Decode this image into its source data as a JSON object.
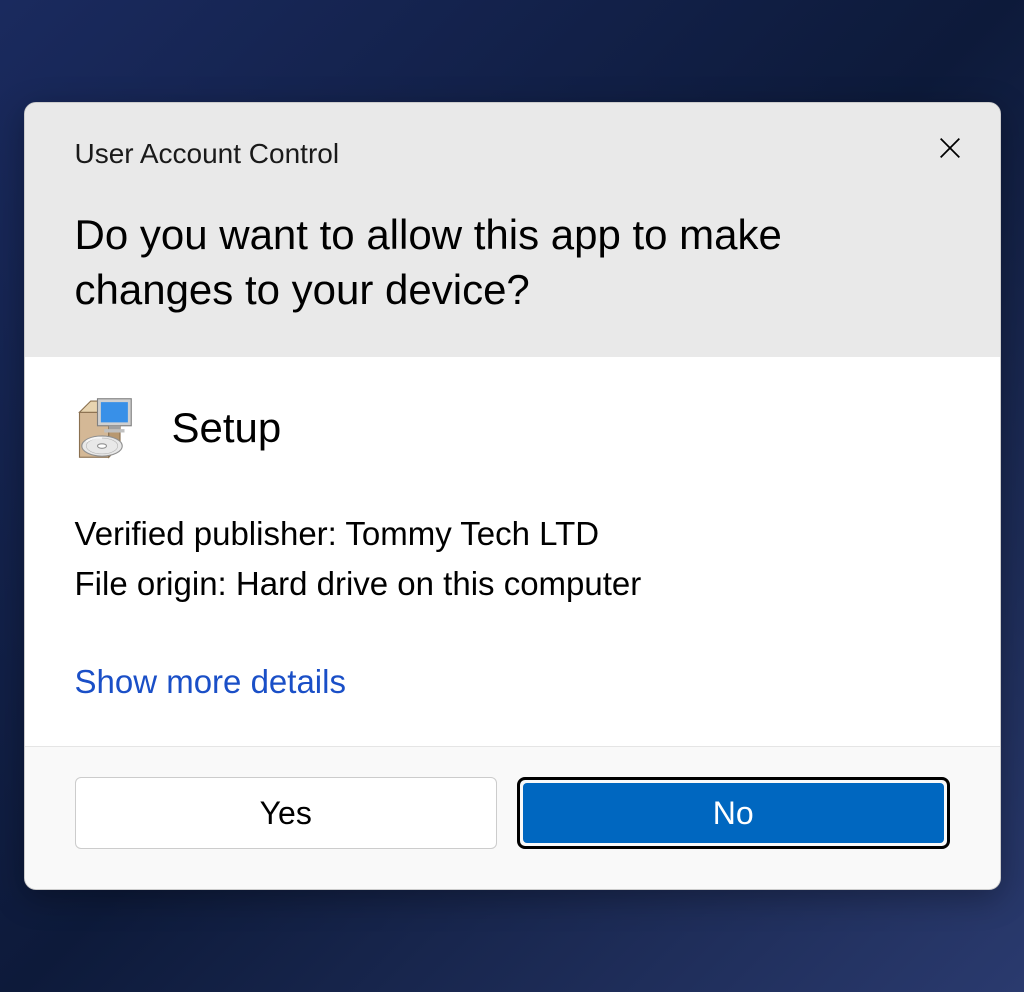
{
  "dialog": {
    "title": "User Account Control",
    "question": "Do you want to allow this app to make changes to your device?",
    "close_label": "Close"
  },
  "app": {
    "name": "Setup",
    "publisher_label": "Verified publisher:",
    "publisher_value": "Tommy Tech LTD",
    "origin_label": "File origin:",
    "origin_value": "Hard drive on this computer"
  },
  "actions": {
    "details_link": "Show more details",
    "yes_label": "Yes",
    "no_label": "No"
  }
}
